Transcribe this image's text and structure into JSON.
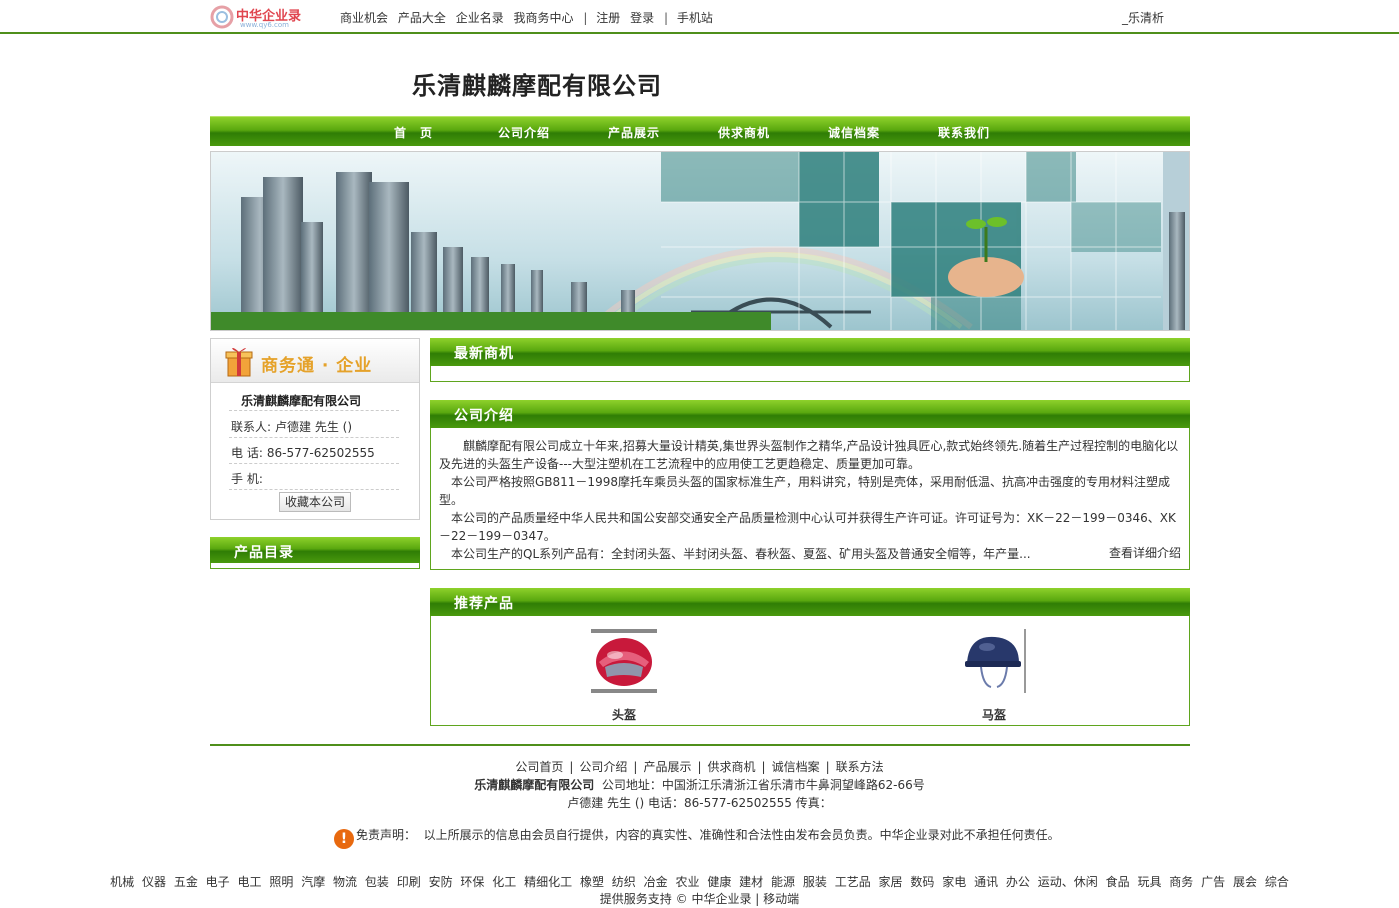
{
  "topbar": {
    "logo_text": "中华企业录",
    "logo_sub": "www.qy6.com",
    "nav": [
      "商业机会",
      "产品大全",
      "企业名录",
      "我商务中心"
    ],
    "nav2": [
      "注册",
      "登录"
    ],
    "nav3": "手机站",
    "right": "_乐清析"
  },
  "company": {
    "title": "乐清麒麟摩配有限公司"
  },
  "mainnav": [
    "首　页",
    "公司介绍",
    "产品展示",
    "供求商机",
    "诚信档案",
    "联系我们"
  ],
  "left": {
    "header": "商务通 · 企业",
    "company_name": "乐清麒麟摩配有限公司",
    "contact_label": "联系人:",
    "contact_value": "卢德建  先生  ()",
    "phone_label": "电  话:",
    "phone_value": "86-577-62502555",
    "mobile_label": "手  机:",
    "mobile_value": "",
    "fav_button": "收藏本公司",
    "catalog_title": "产品目录"
  },
  "panels": {
    "latest_title": "最新商机",
    "intro_title": "公司介绍",
    "intro_paragraphs": [
      "麒麟摩配有限公司成立十年来,招募大量设计精英,集世界头盔制作之精华,产品设计独具匠心,款式始终领先.随着生产过程控制的电脑化以及先进的头盔生产设备---大型注塑机在工艺流程中的应用使工艺更趋稳定、质量更加可靠。",
      "本公司严格按照GB811－1998摩托车乘员头盔的国家标准生产，用料讲究，特别是壳体，采用耐低温、抗高冲击强度的专用材料注塑成型。",
      "本公司的产品质量经中华人民共和国公安部交通安全产品质量检测中心认可并获得生产许可证。许可证号为：XK－22－199－0346、XK－22－199－0347。",
      "本公司生产的QL系列产品有：全封闭头盔、半封闭头盔、春秋盔、夏盔、矿用头盔及普通安全帽等，年产量..."
    ],
    "intro_more": "查看详细介绍",
    "recommend_title": "推荐产品",
    "products": [
      {
        "name": "头盔",
        "icon": "helmet-image"
      },
      {
        "name": "马盔",
        "icon": "riding-helmet-image"
      }
    ]
  },
  "footer": {
    "nav": [
      "公司首页",
      "公司介绍",
      "产品展示",
      "供求商机",
      "诚信档案",
      "联系方法"
    ],
    "company": "乐清麒麟摩配有限公司",
    "address": "公司地址：中国浙江乐清浙江省乐清市牛鼻洞望峰路62-66号",
    "contact_line": "卢德建  先生  () 电话：86-577-62502555 传真：",
    "disclaimer_label": "免责声明：",
    "disclaimer_text": "以上所展示的信息由会员自行提供，内容的真实性、准确性和合法性由发布会员负责。中华企业录对此不承担任何责任。",
    "categories": [
      "机械",
      "仪器",
      "五金",
      "电子",
      "电工",
      "照明",
      "汽摩",
      "物流",
      "包装",
      "印刷",
      "安防",
      "环保",
      "化工",
      "精细化工",
      "橡塑",
      "纺织",
      "冶金",
      "农业",
      "健康",
      "建材",
      "能源",
      "服装",
      "工艺品",
      "家居",
      "数码",
      "家电",
      "通讯",
      "办公",
      "运动、休闲",
      "食品",
      "玩具",
      "商务",
      "广告",
      "展会",
      "综合"
    ],
    "provider_label": "提供服务支持 ©",
    "provider_name": "中华企业录",
    "mobile": "移动端"
  },
  "colors": {
    "green_dark": "#2f7d05",
    "green_light": "#8ed12b",
    "border_green": "#5fa51e",
    "warn_orange": "#e8690f"
  }
}
